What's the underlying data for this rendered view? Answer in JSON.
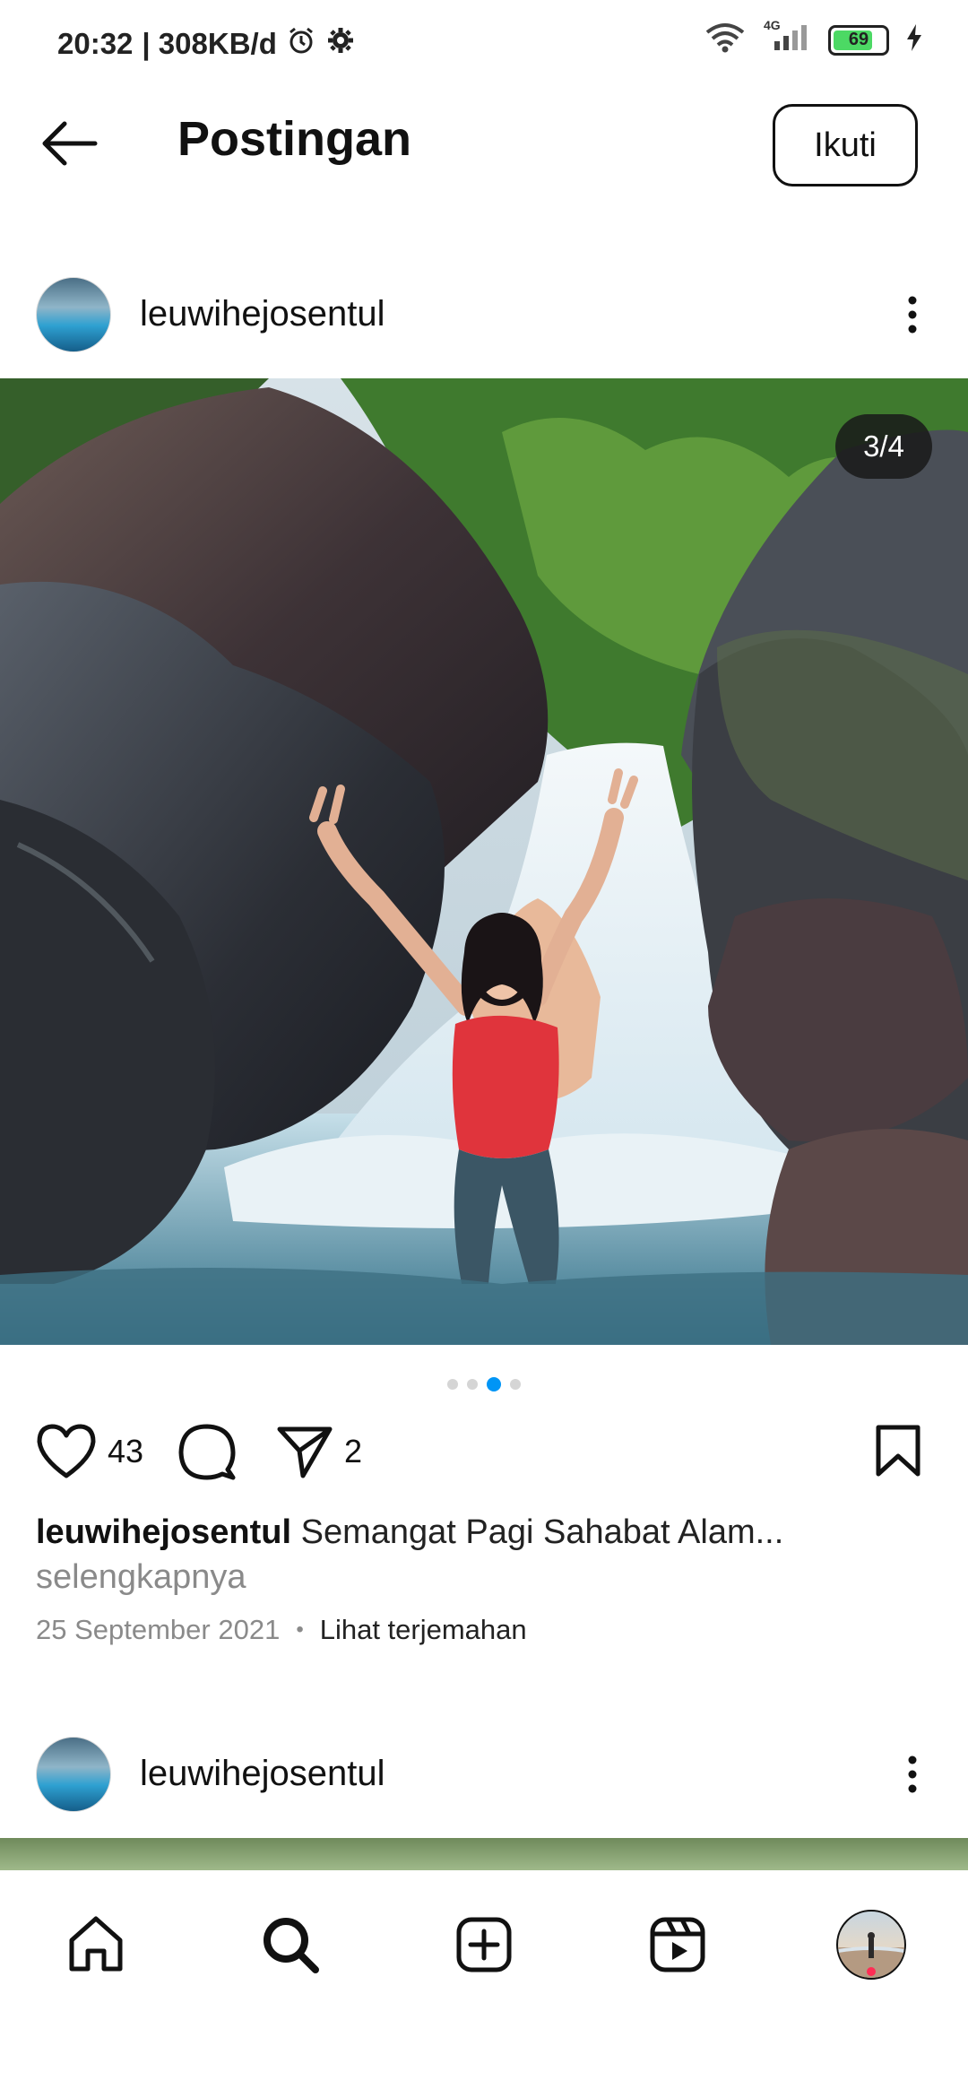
{
  "status_bar": {
    "time": "20:32",
    "net_speed": "| 308KB/d",
    "network": "4G",
    "battery": "69"
  },
  "header": {
    "title": "Postingan",
    "follow_label": "Ikuti"
  },
  "post1": {
    "username": "leuwihejosentul",
    "counter": "3/4",
    "likes": "43",
    "shares": "2",
    "caption_user": "leuwihejosentul",
    "caption_text": "Semangat Pagi Sahabat Alam...",
    "more_label": "selengkapnya",
    "date": "25 September 2021",
    "separator": "•",
    "translate_label": "Lihat terjemahan"
  },
  "post2": {
    "username": "leuwihejosentul"
  },
  "carousel": {
    "total": 4,
    "active_index": 3
  },
  "colors": {
    "accent": "#0095f6",
    "notification": "#ff2d55",
    "battery": "#4cd964"
  },
  "icons": [
    "back-arrow-icon",
    "more-options-icon",
    "heart-icon",
    "comment-icon",
    "share-icon",
    "bookmark-icon",
    "home-icon",
    "search-icon",
    "create-icon",
    "reels-icon",
    "alarm-icon",
    "gear-icon",
    "wifi-icon",
    "signal-icon",
    "battery-icon",
    "charging-icon"
  ]
}
